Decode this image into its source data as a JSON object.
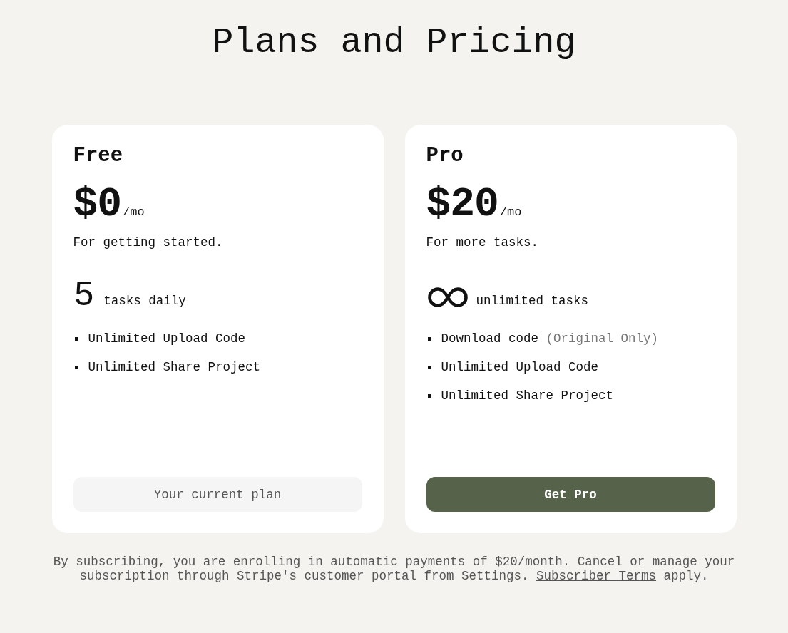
{
  "title": "Plans and Pricing",
  "plans": [
    {
      "name": "Free",
      "price": "$0",
      "period": "/mo",
      "tagline": "For getting started.",
      "quota": {
        "kind": "number",
        "value": "5",
        "label": "tasks daily"
      },
      "features": [
        {
          "text": "Unlimited Upload Code"
        },
        {
          "text": "Unlimited Share Project"
        }
      ],
      "button": {
        "label": "Your current plan",
        "disabled": true
      }
    },
    {
      "name": "Pro",
      "price": "$20",
      "period": "/mo",
      "tagline": "For more tasks.",
      "quota": {
        "kind": "unlimited",
        "label": "unlimited tasks"
      },
      "features": [
        {
          "text": "Download code",
          "note": "(Original Only)"
        },
        {
          "text": "Unlimited Upload Code"
        },
        {
          "text": "Unlimited Share Project"
        }
      ],
      "button": {
        "label": "Get Pro",
        "disabled": false
      }
    }
  ],
  "notice": {
    "text_before": "By subscribing, you are enrolling in automatic payments of $20/month. Cancel or manage your subscription through Stripe's customer portal from Settings.",
    "link": "Subscriber Terms",
    "text_after": "apply."
  }
}
